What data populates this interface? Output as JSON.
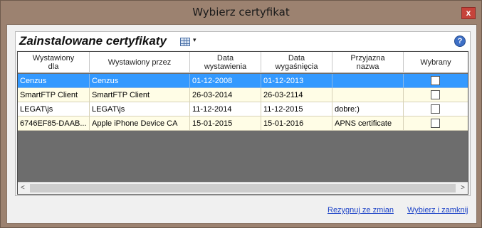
{
  "window": {
    "title": "Wybierz certyfikat",
    "close_glyph": "x"
  },
  "panel": {
    "title": "Zainstalowane certyfikaty",
    "view_icon": "grid-view-icon",
    "help_glyph": "?"
  },
  "table": {
    "columns": [
      "Wystawiony\ndla",
      "Wystawiony przez",
      "Data\nwystawienia",
      "Data\nwygaśnięcia",
      "Przyjazna\nnazwa",
      "Wybrany"
    ],
    "rows": [
      {
        "issued_to": "Cenzus",
        "issued_by": "Cenzus",
        "issue_date": "01-12-2008",
        "expiry_date": "01-12-2013",
        "friendly_name": "",
        "selected": false,
        "highlighted": true
      },
      {
        "issued_to": "SmartFTP Client",
        "issued_by": "SmartFTP Client",
        "issue_date": "26-03-2014",
        "expiry_date": "26-03-2114",
        "friendly_name": "",
        "selected": false,
        "highlighted": false
      },
      {
        "issued_to": "LEGAT\\js",
        "issued_by": "LEGAT\\js",
        "issue_date": "11-12-2014",
        "expiry_date": "11-12-2015",
        "friendly_name": "dobre:)",
        "selected": false,
        "highlighted": false
      },
      {
        "issued_to": "6746EF85-DAAB...",
        "issued_by": "Apple iPhone Device CA",
        "issue_date": "15-01-2015",
        "expiry_date": "15-01-2016",
        "friendly_name": "APNS certificate",
        "selected": false,
        "highlighted": false
      }
    ]
  },
  "footer": {
    "cancel_link": "Rezygnuj ze zmian",
    "confirm_link": "Wybierz i zamknij"
  },
  "colors": {
    "selection": "#3399ff",
    "row_bg": "#fffde6",
    "link": "#1d43c7",
    "frame": "#9c8270"
  }
}
